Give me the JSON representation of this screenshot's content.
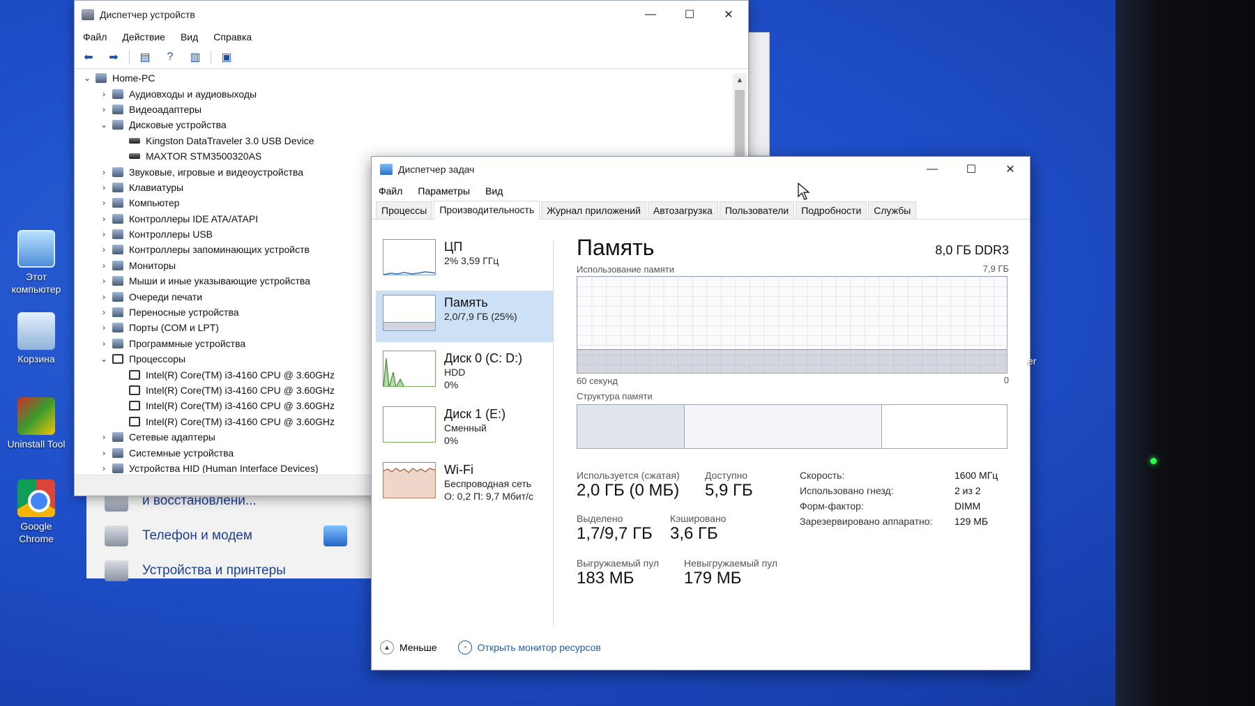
{
  "desktop": {
    "icons": [
      {
        "label": "Этот компьютер"
      },
      {
        "label": "Корзина"
      },
      {
        "label": "Uninstall Tool"
      },
      {
        "label": "Google Chrome"
      }
    ]
  },
  "control_panel": {
    "items": [
      "и восстановлени...",
      "Телефон и модем",
      "Устройства и принтеры"
    ]
  },
  "device_manager": {
    "title": "Диспетчер устройств",
    "menu": [
      "Файл",
      "Действие",
      "Вид",
      "Справка"
    ],
    "tree": [
      {
        "level": 0,
        "expanded": true,
        "label": "Home-PC",
        "icon": "computer-icon"
      },
      {
        "level": 1,
        "expanded": false,
        "label": "Аудиовходы и аудиовыходы",
        "icon": "audio-icon"
      },
      {
        "level": 1,
        "expanded": false,
        "label": "Видеоадаптеры",
        "icon": "display-adapter-icon"
      },
      {
        "level": 1,
        "expanded": true,
        "label": "Дисковые устройства",
        "icon": "disk-icon"
      },
      {
        "level": 2,
        "label": "Kingston DataTraveler 3.0 USB Device",
        "icon": "drive-icon"
      },
      {
        "level": 2,
        "label": "MAXTOR STM3500320AS",
        "icon": "drive-icon"
      },
      {
        "level": 1,
        "expanded": false,
        "label": "Звуковые, игровые и видеоустройства",
        "icon": "sound-icon"
      },
      {
        "level": 1,
        "expanded": false,
        "label": "Клавиатуры",
        "icon": "keyboard-icon"
      },
      {
        "level": 1,
        "expanded": false,
        "label": "Компьютер",
        "icon": "computer-icon"
      },
      {
        "level": 1,
        "expanded": false,
        "label": "Контроллеры IDE ATA/ATAPI",
        "icon": "ide-icon"
      },
      {
        "level": 1,
        "expanded": false,
        "label": "Контроллеры USB",
        "icon": "usb-icon"
      },
      {
        "level": 1,
        "expanded": false,
        "label": "Контроллеры запоминающих устройств",
        "icon": "storage-icon"
      },
      {
        "level": 1,
        "expanded": false,
        "label": "Мониторы",
        "icon": "monitor-icon"
      },
      {
        "level": 1,
        "expanded": false,
        "label": "Мыши и иные указывающие устройства",
        "icon": "mouse-icon"
      },
      {
        "level": 1,
        "expanded": false,
        "label": "Очереди печати",
        "icon": "printer-icon"
      },
      {
        "level": 1,
        "expanded": false,
        "label": "Переносные устройства",
        "icon": "portable-icon"
      },
      {
        "level": 1,
        "expanded": false,
        "label": "Порты (COM и LPT)",
        "icon": "port-icon"
      },
      {
        "level": 1,
        "expanded": false,
        "label": "Программные устройства",
        "icon": "software-icon"
      },
      {
        "level": 1,
        "expanded": true,
        "label": "Процессоры",
        "icon": "cpu-icon"
      },
      {
        "level": 2,
        "label": "Intel(R) Core(TM) i3-4160 CPU @ 3.60GHz",
        "icon": "cpu-icon"
      },
      {
        "level": 2,
        "label": "Intel(R) Core(TM) i3-4160 CPU @ 3.60GHz",
        "icon": "cpu-icon"
      },
      {
        "level": 2,
        "label": "Intel(R) Core(TM) i3-4160 CPU @ 3.60GHz",
        "icon": "cpu-icon"
      },
      {
        "level": 2,
        "label": "Intel(R) Core(TM) i3-4160 CPU @ 3.60GHz",
        "icon": "cpu-icon"
      },
      {
        "level": 1,
        "expanded": false,
        "label": "Сетевые адаптеры",
        "icon": "network-icon"
      },
      {
        "level": 1,
        "expanded": false,
        "label": "Системные устройства",
        "icon": "system-icon"
      },
      {
        "level": 1,
        "expanded": false,
        "label": "Устройства HID (Human Interface Devices)",
        "icon": "hid-icon"
      }
    ]
  },
  "task_manager": {
    "title": "Диспетчер задач",
    "menu": [
      "Файл",
      "Параметры",
      "Вид"
    ],
    "tabs": [
      "Процессы",
      "Производительность",
      "Журнал приложений",
      "Автозагрузка",
      "Пользователи",
      "Подробности",
      "Службы"
    ],
    "active_tab": "Производительность",
    "sidebar": [
      {
        "name": "ЦП",
        "lines": [
          "2% 3,59 ГГц"
        ]
      },
      {
        "name": "Память",
        "lines": [
          "2,0/7,9 ГБ (25%)"
        ],
        "selected": true
      },
      {
        "name": "Диск 0 (C: D:)",
        "lines": [
          "HDD",
          "0%"
        ]
      },
      {
        "name": "Диск 1 (E:)",
        "lines": [
          "Сменный",
          "0%"
        ]
      },
      {
        "name": "Wi-Fi",
        "lines": [
          "Беспроводная сеть",
          "О: 0,2 П: 9,7 Мбит/с"
        ]
      }
    ],
    "memory": {
      "title": "Память",
      "model": "8,0 ГБ DDR3",
      "usage_label": "Использование памяти",
      "usage_max": "7,9 ГБ",
      "time_left": "60 секунд",
      "time_right": "0",
      "usage_fraction": 0.25,
      "structure_label": "Структура памяти",
      "structure_fractions": [
        0.25,
        0.46,
        0.29
      ],
      "stats": {
        "in_use_label": "Используется (сжатая)",
        "in_use_value": "2,0 ГБ (0 МБ)",
        "available_label": "Доступно",
        "available_value": "5,9 ГБ",
        "committed_label": "Выделено",
        "committed_value": "1,7/9,7 ГБ",
        "cached_label": "Кэшировано",
        "cached_value": "3,6 ГБ",
        "paged_label": "Выгружаемый пул",
        "paged_value": "183 МБ",
        "nonpaged_label": "Невыгружаемый пул",
        "nonpaged_value": "179 МБ"
      },
      "props": [
        {
          "label": "Скорость:",
          "value": "1600 МГц"
        },
        {
          "label": "Использовано гнезд:",
          "value": "2 из 2"
        },
        {
          "label": "Форм-фактор:",
          "value": "DIMM"
        },
        {
          "label": "Зарезервировано аппаратно:",
          "value": "129 МБ"
        }
      ]
    },
    "footer": {
      "less": "Меньше",
      "monitor_link": "Открыть монитор ресурсов"
    }
  },
  "behind_window_fragment": "er"
}
